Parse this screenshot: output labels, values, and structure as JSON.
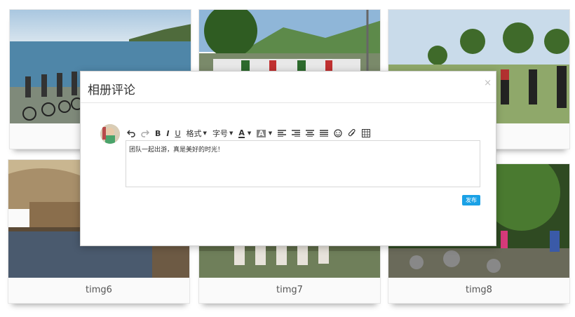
{
  "gallery": {
    "captions": {
      "top_left": "",
      "top_mid": "",
      "top_right": "",
      "bottom_left": "timg6",
      "bottom_mid": "timg7",
      "bottom_right": "timg8"
    }
  },
  "modal": {
    "title": "相册评论",
    "close_symbol": "×",
    "toolbar": {
      "format_label": "格式",
      "fontsize_label": "字号",
      "text_color_label": "A",
      "bg_color_label": "A",
      "icons": [
        "undo-icon",
        "redo-icon",
        "bold-icon",
        "italic-icon",
        "underline-icon",
        "align-left-icon",
        "align-right-icon",
        "align-center-icon",
        "justify-icon",
        "emoji-icon",
        "attachment-icon",
        "table-icon"
      ]
    },
    "editor_text": "团队一起出游，真是美好的时光！",
    "publish_label": "发布"
  },
  "colors": {
    "accent": "#1aa1e6"
  }
}
